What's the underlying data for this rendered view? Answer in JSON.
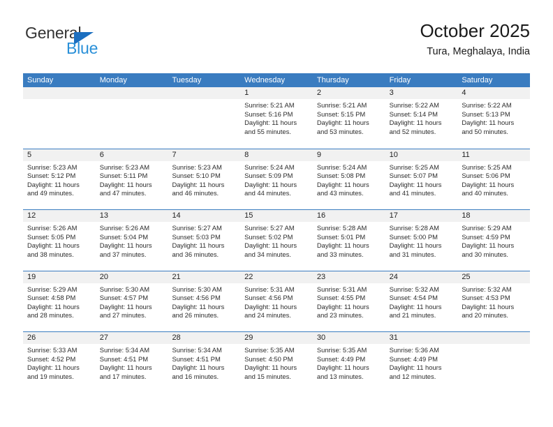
{
  "brand": {
    "name_part1": "General",
    "name_part2": "Blue",
    "accent_color": "#1c6fc0",
    "secondary_color": "#2a90d8"
  },
  "header": {
    "title": "October 2025",
    "subtitle": "Tura, Meghalaya, India"
  },
  "theme": {
    "header_row_bg": "#3a7cc0",
    "day_number_bg": "#f1f1f1",
    "row_divider": "#3a7cc0"
  },
  "weekdays": [
    "Sunday",
    "Monday",
    "Tuesday",
    "Wednesday",
    "Thursday",
    "Friday",
    "Saturday"
  ],
  "weeks": [
    [
      {
        "day": "",
        "sunrise": "",
        "sunset": "",
        "daylight_line1": "",
        "daylight_line2": ""
      },
      {
        "day": "",
        "sunrise": "",
        "sunset": "",
        "daylight_line1": "",
        "daylight_line2": ""
      },
      {
        "day": "",
        "sunrise": "",
        "sunset": "",
        "daylight_line1": "",
        "daylight_line2": ""
      },
      {
        "day": "1",
        "sunrise": "Sunrise: 5:21 AM",
        "sunset": "Sunset: 5:16 PM",
        "daylight_line1": "Daylight: 11 hours",
        "daylight_line2": "and 55 minutes."
      },
      {
        "day": "2",
        "sunrise": "Sunrise: 5:21 AM",
        "sunset": "Sunset: 5:15 PM",
        "daylight_line1": "Daylight: 11 hours",
        "daylight_line2": "and 53 minutes."
      },
      {
        "day": "3",
        "sunrise": "Sunrise: 5:22 AM",
        "sunset": "Sunset: 5:14 PM",
        "daylight_line1": "Daylight: 11 hours",
        "daylight_line2": "and 52 minutes."
      },
      {
        "day": "4",
        "sunrise": "Sunrise: 5:22 AM",
        "sunset": "Sunset: 5:13 PM",
        "daylight_line1": "Daylight: 11 hours",
        "daylight_line2": "and 50 minutes."
      }
    ],
    [
      {
        "day": "5",
        "sunrise": "Sunrise: 5:23 AM",
        "sunset": "Sunset: 5:12 PM",
        "daylight_line1": "Daylight: 11 hours",
        "daylight_line2": "and 49 minutes."
      },
      {
        "day": "6",
        "sunrise": "Sunrise: 5:23 AM",
        "sunset": "Sunset: 5:11 PM",
        "daylight_line1": "Daylight: 11 hours",
        "daylight_line2": "and 47 minutes."
      },
      {
        "day": "7",
        "sunrise": "Sunrise: 5:23 AM",
        "sunset": "Sunset: 5:10 PM",
        "daylight_line1": "Daylight: 11 hours",
        "daylight_line2": "and 46 minutes."
      },
      {
        "day": "8",
        "sunrise": "Sunrise: 5:24 AM",
        "sunset": "Sunset: 5:09 PM",
        "daylight_line1": "Daylight: 11 hours",
        "daylight_line2": "and 44 minutes."
      },
      {
        "day": "9",
        "sunrise": "Sunrise: 5:24 AM",
        "sunset": "Sunset: 5:08 PM",
        "daylight_line1": "Daylight: 11 hours",
        "daylight_line2": "and 43 minutes."
      },
      {
        "day": "10",
        "sunrise": "Sunrise: 5:25 AM",
        "sunset": "Sunset: 5:07 PM",
        "daylight_line1": "Daylight: 11 hours",
        "daylight_line2": "and 41 minutes."
      },
      {
        "day": "11",
        "sunrise": "Sunrise: 5:25 AM",
        "sunset": "Sunset: 5:06 PM",
        "daylight_line1": "Daylight: 11 hours",
        "daylight_line2": "and 40 minutes."
      }
    ],
    [
      {
        "day": "12",
        "sunrise": "Sunrise: 5:26 AM",
        "sunset": "Sunset: 5:05 PM",
        "daylight_line1": "Daylight: 11 hours",
        "daylight_line2": "and 38 minutes."
      },
      {
        "day": "13",
        "sunrise": "Sunrise: 5:26 AM",
        "sunset": "Sunset: 5:04 PM",
        "daylight_line1": "Daylight: 11 hours",
        "daylight_line2": "and 37 minutes."
      },
      {
        "day": "14",
        "sunrise": "Sunrise: 5:27 AM",
        "sunset": "Sunset: 5:03 PM",
        "daylight_line1": "Daylight: 11 hours",
        "daylight_line2": "and 36 minutes."
      },
      {
        "day": "15",
        "sunrise": "Sunrise: 5:27 AM",
        "sunset": "Sunset: 5:02 PM",
        "daylight_line1": "Daylight: 11 hours",
        "daylight_line2": "and 34 minutes."
      },
      {
        "day": "16",
        "sunrise": "Sunrise: 5:28 AM",
        "sunset": "Sunset: 5:01 PM",
        "daylight_line1": "Daylight: 11 hours",
        "daylight_line2": "and 33 minutes."
      },
      {
        "day": "17",
        "sunrise": "Sunrise: 5:28 AM",
        "sunset": "Sunset: 5:00 PM",
        "daylight_line1": "Daylight: 11 hours",
        "daylight_line2": "and 31 minutes."
      },
      {
        "day": "18",
        "sunrise": "Sunrise: 5:29 AM",
        "sunset": "Sunset: 4:59 PM",
        "daylight_line1": "Daylight: 11 hours",
        "daylight_line2": "and 30 minutes."
      }
    ],
    [
      {
        "day": "19",
        "sunrise": "Sunrise: 5:29 AM",
        "sunset": "Sunset: 4:58 PM",
        "daylight_line1": "Daylight: 11 hours",
        "daylight_line2": "and 28 minutes."
      },
      {
        "day": "20",
        "sunrise": "Sunrise: 5:30 AM",
        "sunset": "Sunset: 4:57 PM",
        "daylight_line1": "Daylight: 11 hours",
        "daylight_line2": "and 27 minutes."
      },
      {
        "day": "21",
        "sunrise": "Sunrise: 5:30 AM",
        "sunset": "Sunset: 4:56 PM",
        "daylight_line1": "Daylight: 11 hours",
        "daylight_line2": "and 26 minutes."
      },
      {
        "day": "22",
        "sunrise": "Sunrise: 5:31 AM",
        "sunset": "Sunset: 4:56 PM",
        "daylight_line1": "Daylight: 11 hours",
        "daylight_line2": "and 24 minutes."
      },
      {
        "day": "23",
        "sunrise": "Sunrise: 5:31 AM",
        "sunset": "Sunset: 4:55 PM",
        "daylight_line1": "Daylight: 11 hours",
        "daylight_line2": "and 23 minutes."
      },
      {
        "day": "24",
        "sunrise": "Sunrise: 5:32 AM",
        "sunset": "Sunset: 4:54 PM",
        "daylight_line1": "Daylight: 11 hours",
        "daylight_line2": "and 21 minutes."
      },
      {
        "day": "25",
        "sunrise": "Sunrise: 5:32 AM",
        "sunset": "Sunset: 4:53 PM",
        "daylight_line1": "Daylight: 11 hours",
        "daylight_line2": "and 20 minutes."
      }
    ],
    [
      {
        "day": "26",
        "sunrise": "Sunrise: 5:33 AM",
        "sunset": "Sunset: 4:52 PM",
        "daylight_line1": "Daylight: 11 hours",
        "daylight_line2": "and 19 minutes."
      },
      {
        "day": "27",
        "sunrise": "Sunrise: 5:34 AM",
        "sunset": "Sunset: 4:51 PM",
        "daylight_line1": "Daylight: 11 hours",
        "daylight_line2": "and 17 minutes."
      },
      {
        "day": "28",
        "sunrise": "Sunrise: 5:34 AM",
        "sunset": "Sunset: 4:51 PM",
        "daylight_line1": "Daylight: 11 hours",
        "daylight_line2": "and 16 minutes."
      },
      {
        "day": "29",
        "sunrise": "Sunrise: 5:35 AM",
        "sunset": "Sunset: 4:50 PM",
        "daylight_line1": "Daylight: 11 hours",
        "daylight_line2": "and 15 minutes."
      },
      {
        "day": "30",
        "sunrise": "Sunrise: 5:35 AM",
        "sunset": "Sunset: 4:49 PM",
        "daylight_line1": "Daylight: 11 hours",
        "daylight_line2": "and 13 minutes."
      },
      {
        "day": "31",
        "sunrise": "Sunrise: 5:36 AM",
        "sunset": "Sunset: 4:49 PM",
        "daylight_line1": "Daylight: 11 hours",
        "daylight_line2": "and 12 minutes."
      },
      {
        "day": "",
        "sunrise": "",
        "sunset": "",
        "daylight_line1": "",
        "daylight_line2": ""
      }
    ]
  ]
}
